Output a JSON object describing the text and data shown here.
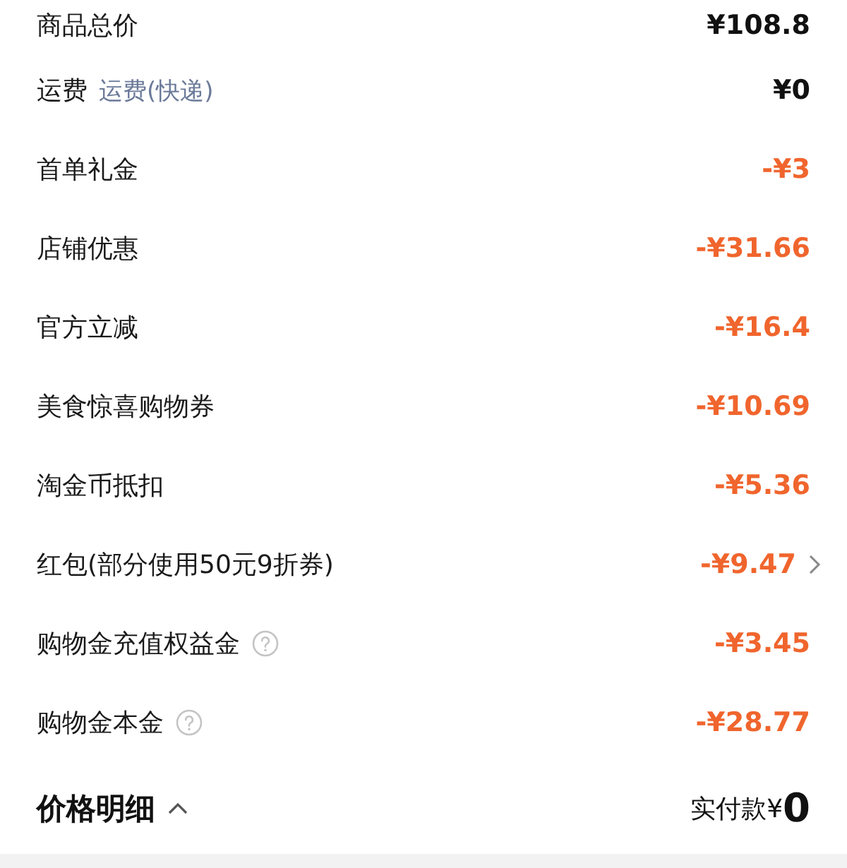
{
  "rows": [
    {
      "label": "商品总价",
      "value": "¥108.8",
      "discount": false,
      "help": false,
      "arrow": false
    },
    {
      "label": "运费",
      "note": "运费(快递)",
      "value": "¥0",
      "discount": false,
      "help": false,
      "arrow": false
    },
    {
      "label": "首单礼金",
      "value": "-¥3",
      "discount": true,
      "help": false,
      "arrow": false
    },
    {
      "label": "店铺优惠",
      "value": "-¥31.66",
      "discount": true,
      "help": false,
      "arrow": false
    },
    {
      "label": "官方立减",
      "value": "-¥16.4",
      "discount": true,
      "help": false,
      "arrow": false
    },
    {
      "label": "美食惊喜购物券",
      "value": "-¥10.69",
      "discount": true,
      "help": false,
      "arrow": false
    },
    {
      "label": "淘金币抵扣",
      "value": "-¥5.36",
      "discount": true,
      "help": false,
      "arrow": false
    },
    {
      "label": "红包(部分使用50元9折券)",
      "value": "-¥9.47",
      "discount": true,
      "help": false,
      "arrow": true
    },
    {
      "label": "购物金充值权益金",
      "value": "-¥3.45",
      "discount": true,
      "help": true,
      "arrow": false
    },
    {
      "label": "购物金本金",
      "value": "-¥28.77",
      "discount": true,
      "help": true,
      "arrow": false
    }
  ],
  "footer": {
    "title": "价格明细",
    "expanded": true,
    "total_label": "实付款¥",
    "total": "0"
  }
}
